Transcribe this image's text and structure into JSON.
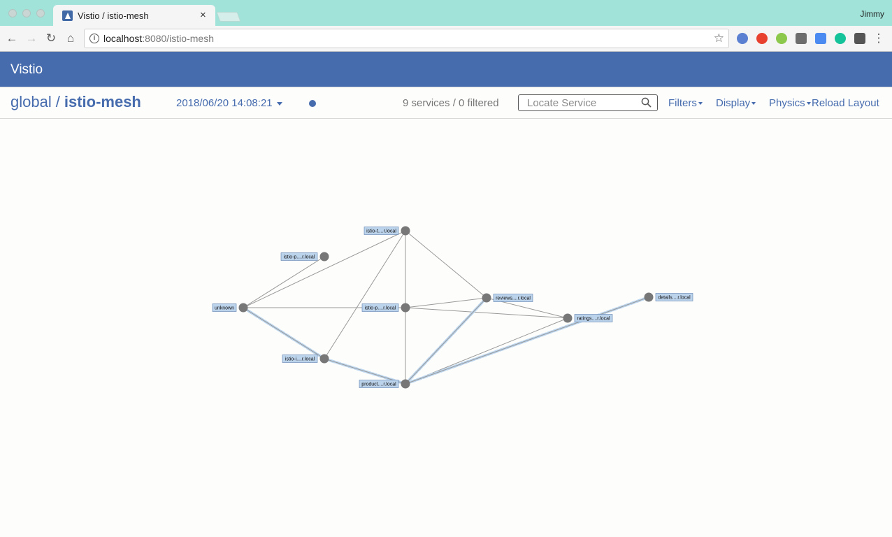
{
  "browser": {
    "tab_title": "Vistio / istio-mesh",
    "profile_name": "Jimmy",
    "url_host": "localhost",
    "url_path": ":8080/istio-mesh",
    "extension_icons": [
      "vpn-icon",
      "opera-icon",
      "node-icon",
      "pocket-icon",
      "translate-icon",
      "grammarly-icon",
      "dashlane-icon"
    ]
  },
  "app": {
    "brand": "Vistio",
    "breadcrumb": {
      "root": "global",
      "separator": "/",
      "current": "istio-mesh"
    },
    "timestamp": "2018/06/20 14:08:21",
    "service_count_text": "9 services / 0 filtered",
    "search": {
      "placeholder": "Locate Service",
      "value": ""
    },
    "menus": {
      "filters": "Filters",
      "display": "Display",
      "physics": "Physics",
      "reload": "Reload Layout"
    },
    "colors": {
      "header": "#466cae",
      "accent": "#466cae",
      "node": "#777777",
      "label_bg": "#bcd3ec",
      "edge": "#999999",
      "traffic": "#bcd6ef"
    }
  },
  "graph": {
    "nodes": [
      {
        "id": "istio-telemetry",
        "label": "istio-t....r.local"
      },
      {
        "id": "istio-policy",
        "label": "istio-p....r.local"
      },
      {
        "id": "unknown",
        "label": "unknown"
      },
      {
        "id": "istio-pilot",
        "label": "istio-p....r.local"
      },
      {
        "id": "reviews",
        "label": "reviews....r.local"
      },
      {
        "id": "ratings",
        "label": "ratings....r.local"
      },
      {
        "id": "details",
        "label": "details....r.local"
      },
      {
        "id": "istio-ingress",
        "label": "istio-i....r.local"
      },
      {
        "id": "productpage",
        "label": "product....r.local"
      }
    ],
    "edges": [
      {
        "from": "unknown",
        "to": "istio-policy",
        "traffic": false
      },
      {
        "from": "unknown",
        "to": "istio-telemetry",
        "traffic": false
      },
      {
        "from": "unknown",
        "to": "istio-pilot",
        "traffic": false
      },
      {
        "from": "unknown",
        "to": "istio-ingress",
        "traffic": true
      },
      {
        "from": "istio-telemetry",
        "to": "istio-pilot",
        "traffic": false
      },
      {
        "from": "istio-telemetry",
        "to": "reviews",
        "traffic": false
      },
      {
        "from": "istio-telemetry",
        "to": "istio-ingress",
        "traffic": false
      },
      {
        "from": "istio-pilot",
        "to": "reviews",
        "traffic": false
      },
      {
        "from": "istio-pilot",
        "to": "ratings",
        "traffic": false
      },
      {
        "from": "istio-pilot",
        "to": "productpage",
        "traffic": false
      },
      {
        "from": "reviews",
        "to": "ratings",
        "traffic": false
      },
      {
        "from": "istio-ingress",
        "to": "productpage",
        "traffic": true
      },
      {
        "from": "productpage",
        "to": "reviews",
        "traffic": true
      },
      {
        "from": "productpage",
        "to": "ratings",
        "traffic": false
      },
      {
        "from": "productpage",
        "to": "details",
        "traffic": true
      }
    ]
  }
}
